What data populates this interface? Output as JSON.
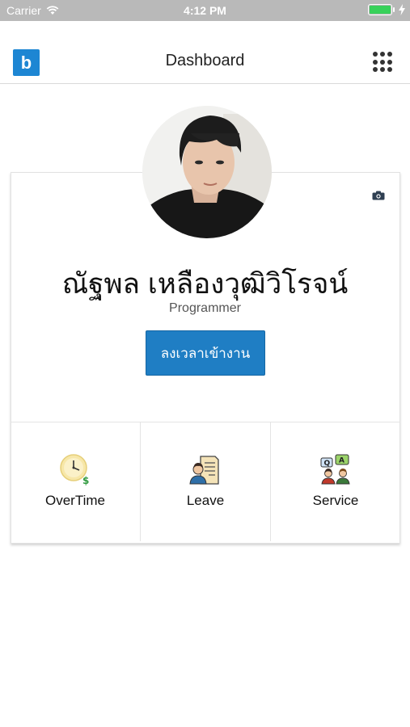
{
  "status_bar": {
    "carrier": "Carrier",
    "time": "4:12 PM",
    "battery_level": 1.0
  },
  "nav": {
    "title": "Dashboard",
    "logo_letter": "b",
    "brand_color": "#1d86d3",
    "menu_icon": "apps-grid-icon"
  },
  "profile": {
    "name": "ณัฐพล เหลืองวุฒิวิโรจน์",
    "role": "Programmer",
    "checkin_label": "ลงเวลาเข้างาน",
    "camera_icon": "camera-icon",
    "avatar_image": "profile-photo"
  },
  "menu": {
    "items": [
      {
        "label": "OverTime",
        "icon": "clock-money-icon"
      },
      {
        "label": "Leave",
        "icon": "person-document-icon"
      },
      {
        "label": "Service",
        "icon": "people-qa-icon"
      }
    ]
  },
  "colors": {
    "accent": "#1f7ec4",
    "status_bar": "#b9b9b9",
    "battery": "#38d15a"
  }
}
